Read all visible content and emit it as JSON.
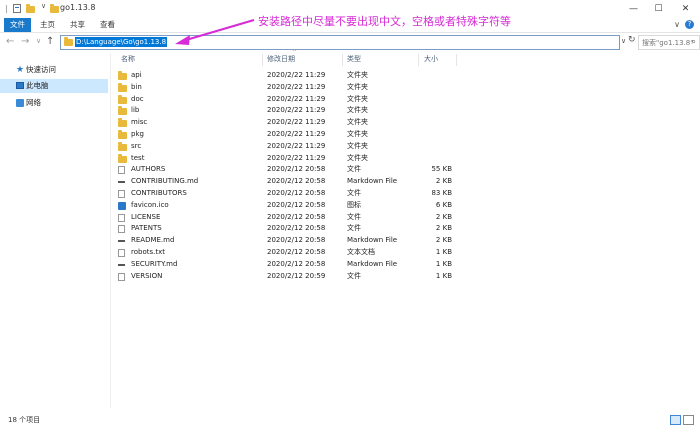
{
  "window": {
    "title": "go1.13.8",
    "minimize": "—",
    "maximize": "☐",
    "close": "✕"
  },
  "ribbon": {
    "tabs": [
      "文件",
      "主页",
      "共享",
      "查看"
    ],
    "help": "?"
  },
  "address": {
    "path": "D:\\Language\\Go\\go1.13.8",
    "search_placeholder": "搜索\"go1.13.8\""
  },
  "annotation": "安装路径中尽量不要出现中文，空格或者特殊字符等",
  "sidebar": {
    "items": [
      {
        "label": "快速访问",
        "icon": "star-icon"
      },
      {
        "label": "此电脑",
        "icon": "computer-icon"
      },
      {
        "label": "网络",
        "icon": "network-icon"
      }
    ]
  },
  "columns": [
    "名称",
    "修改日期",
    "类型",
    "大小"
  ],
  "files": [
    {
      "name": "api",
      "date": "2020/2/22 11:29",
      "type": "文件夹",
      "size": "",
      "icon": "folder-icon"
    },
    {
      "name": "bin",
      "date": "2020/2/22 11:29",
      "type": "文件夹",
      "size": "",
      "icon": "folder-icon"
    },
    {
      "name": "doc",
      "date": "2020/2/22 11:29",
      "type": "文件夹",
      "size": "",
      "icon": "folder-icon"
    },
    {
      "name": "lib",
      "date": "2020/2/22 11:29",
      "type": "文件夹",
      "size": "",
      "icon": "folder-icon"
    },
    {
      "name": "misc",
      "date": "2020/2/22 11:29",
      "type": "文件夹",
      "size": "",
      "icon": "folder-icon"
    },
    {
      "name": "pkg",
      "date": "2020/2/22 11:29",
      "type": "文件夹",
      "size": "",
      "icon": "folder-icon"
    },
    {
      "name": "src",
      "date": "2020/2/22 11:29",
      "type": "文件夹",
      "size": "",
      "icon": "folder-icon"
    },
    {
      "name": "test",
      "date": "2020/2/22 11:29",
      "type": "文件夹",
      "size": "",
      "icon": "folder-icon"
    },
    {
      "name": "AUTHORS",
      "date": "2020/2/12 20:58",
      "type": "文件",
      "size": "55 KB",
      "icon": "file-icon"
    },
    {
      "name": "CONTRIBUTING.md",
      "date": "2020/2/12 20:58",
      "type": "Markdown File",
      "size": "2 KB",
      "icon": "markdown-icon"
    },
    {
      "name": "CONTRIBUTORS",
      "date": "2020/2/12 20:58",
      "type": "文件",
      "size": "83 KB",
      "icon": "file-icon"
    },
    {
      "name": "favicon.ico",
      "date": "2020/2/12 20:58",
      "type": "图标",
      "size": "6 KB",
      "icon": "image-icon"
    },
    {
      "name": "LICENSE",
      "date": "2020/2/12 20:58",
      "type": "文件",
      "size": "2 KB",
      "icon": "file-icon"
    },
    {
      "name": "PATENTS",
      "date": "2020/2/12 20:58",
      "type": "文件",
      "size": "2 KB",
      "icon": "file-icon"
    },
    {
      "name": "README.md",
      "date": "2020/2/12 20:58",
      "type": "Markdown File",
      "size": "2 KB",
      "icon": "markdown-icon"
    },
    {
      "name": "robots.txt",
      "date": "2020/2/12 20:58",
      "type": "文本文档",
      "size": "1 KB",
      "icon": "text-file-icon"
    },
    {
      "name": "SECURITY.md",
      "date": "2020/2/12 20:58",
      "type": "Markdown File",
      "size": "1 KB",
      "icon": "markdown-icon"
    },
    {
      "name": "VERSION",
      "date": "2020/2/12 20:59",
      "type": "文件",
      "size": "1 KB",
      "icon": "file-icon"
    }
  ],
  "status": {
    "item_count": "18 个项目"
  },
  "colors": {
    "accent": "#1979ca",
    "annotation": "#d62bd6",
    "folder": "#e8b93a",
    "selection": "#cce8ff"
  }
}
